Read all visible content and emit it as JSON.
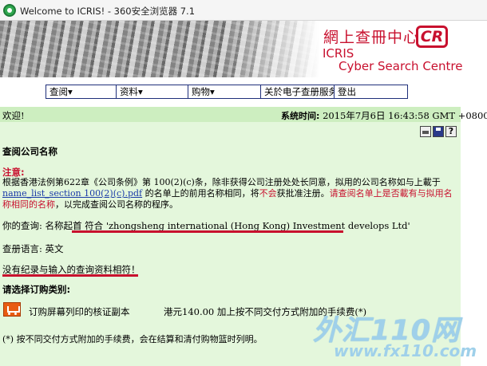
{
  "browser": {
    "title": "Welcome to ICRIS! - 360安全浏览器 7.1"
  },
  "banner": {
    "zh_title": "網上查冊中心",
    "badge": "CR",
    "name_line1": "ICRIS",
    "name_line2": "Cyber Search Centre"
  },
  "menu": {
    "items": [
      {
        "label": "查阅▾"
      },
      {
        "label": "资料▾"
      },
      {
        "label": "购物▾"
      },
      {
        "label": "关於电子查册服务"
      },
      {
        "label": "登出"
      }
    ]
  },
  "status": {
    "welcome": "欢迎!",
    "systime_label": "系统时间:",
    "systime_value": "2015年7月6日 16:43:58 GMT +0800"
  },
  "page": {
    "heading": "查阅公司名称",
    "note_label": "注意:",
    "para_part1": "根据香港法例第622章《公司条例》第 100(2)(c)条，除非获得公司注册处处长同意，拟用的公司名称如与上載于",
    "para_link": "name_list_section 100(2)(c).pdf",
    "para_part2": " 的名单上的前用名称相同，将",
    "para_red_word": "不会",
    "para_part3": "获批准注册。",
    "para_red_sentence": "请查阅名单上是否載有与拟用名称相同的名称",
    "para_part4": "，以完成查阅公司名称的程序。",
    "query_text": "你的查询: 名称起首 符合 'zhongsheng international (Hong Kong) Investment develops Ltd'",
    "lang_text": "查册语言: 英文",
    "result_text": "没有纪录与输入的查询资料相符！",
    "choose_label": "请选择订购类别:",
    "item_label": "订购屏幕列印的核证副本",
    "item_price": "港元140.00 加上按不同交付方式附加的手续费(*)",
    "footnote": "(*) 按不同交付方式附加的手续费，会在结算和清付购物篮时列明。"
  },
  "watermark": {
    "line1": "外汇110网",
    "line2": "www.fx110.com"
  }
}
